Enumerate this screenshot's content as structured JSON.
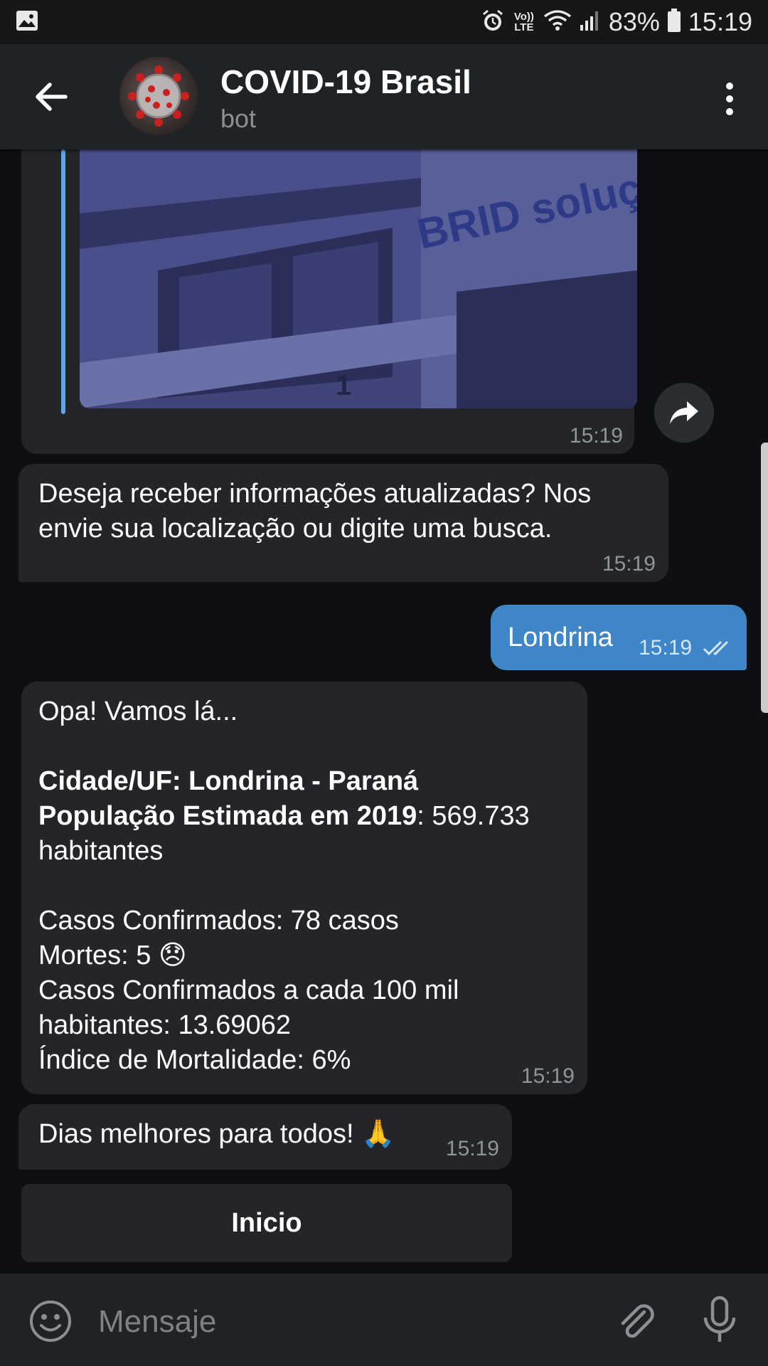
{
  "status_bar": {
    "network_label": "Vo)) LTE",
    "battery": "83%",
    "time": "15:19"
  },
  "header": {
    "title": "COVID-19 Brasil",
    "subtitle": "bot"
  },
  "messages": {
    "photo_msg": {
      "time": "15:19",
      "photo_sign": "BRID soluções",
      "door_number": "1"
    },
    "prompt_msg": {
      "text": "Deseja receber informações atualizadas? Nos\nenvie sua localização ou digite uma busca.",
      "time": "15:19"
    },
    "user_msg": {
      "text": "Londrina",
      "time": "15:19"
    },
    "info_msg": {
      "greeting": "Opa! Vamos lá...",
      "city_label": "Cidade/UF: Londrina - Paraná",
      "pop_label": "População Estimada em 2019",
      "pop_value": ": 569.733",
      "pop_unit": "habitantes",
      "cases": "Casos Confirmados: 78 casos",
      "deaths": "Mortes: 5 😞",
      "per100k_line1": "Casos Confirmados a cada 100 mil",
      "per100k_line2": "habitantes: 13.69062",
      "mortality": "Índice de Mortalidade: 6%",
      "time": "15:19"
    },
    "closing_msg": {
      "text": "Dias melhores para todos! 🙏",
      "time": "15:19"
    }
  },
  "keyboard": {
    "button_label": "Inicio"
  },
  "input": {
    "placeholder": "Mensaje"
  },
  "colors": {
    "outgoing_bubble": "#3e86c7",
    "incoming_bubble": "#232528",
    "background": "#0d0f12",
    "header": "#202326"
  }
}
